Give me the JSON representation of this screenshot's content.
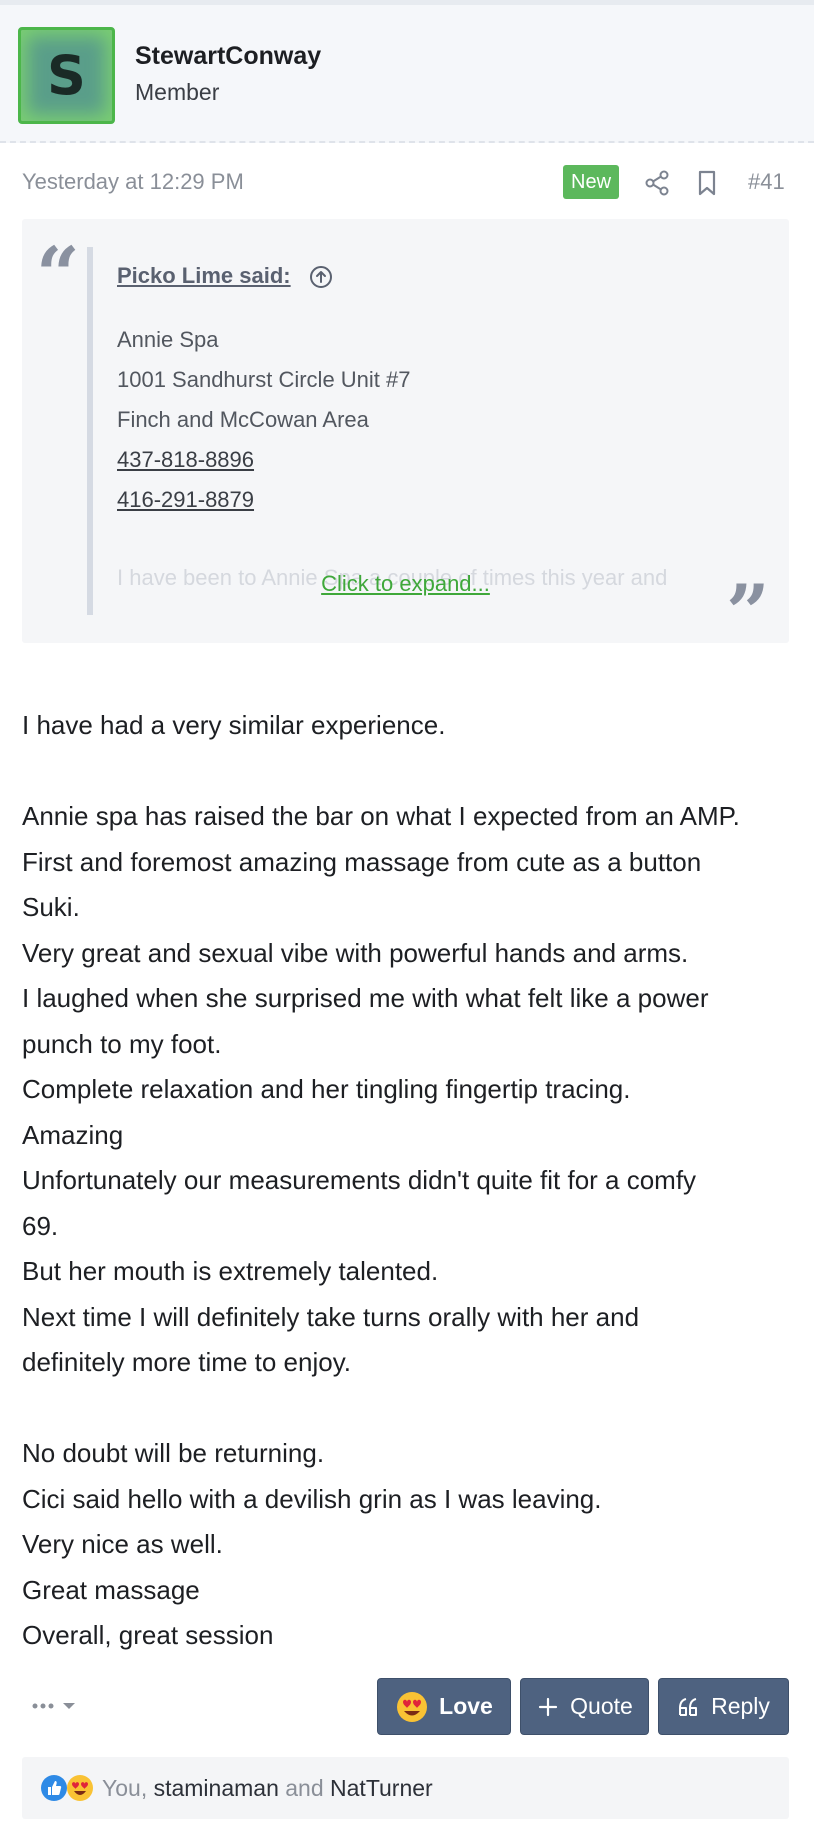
{
  "user": {
    "avatar_letter": "S",
    "name": "StewartConway",
    "title": "Member"
  },
  "post_meta": {
    "date": "Yesterday at 12:29 PM",
    "badge": "New",
    "number": "#41"
  },
  "quote": {
    "attribution": "Picko Lime said:",
    "lines": [
      "Annie Spa",
      "1001 Sandhurst Circle Unit #7",
      "Finch and McCowan Area"
    ],
    "phones": [
      "437-818-8896",
      "416-291-8879"
    ],
    "faded_text": "I have been to Annie Spa a couple of times this year and",
    "expand_label": "Click to expand..."
  },
  "body_lines": [
    "I have had a very similar experience.",
    "",
    "Annie spa has raised the bar on what I expected from an AMP.",
    "First and foremost amazing massage from cute as a button",
    "Suki.",
    "Very great and sexual vibe with powerful hands and arms.",
    "I laughed when she surprised me with what felt like a power",
    "punch to my foot.",
    "Complete relaxation and her tingling fingertip tracing.",
    "Amazing",
    "Unfortunately our measurements didn't quite fit for a comfy",
    "69.",
    "But her mouth is extremely talented.",
    "Next time I will definitely take turns orally with her and",
    "definitely more time to enjoy.",
    "",
    "No doubt will be returning.",
    "Cici said hello with a devilish grin as I was leaving.",
    "Very nice as well.",
    "Great massage",
    "Overall, great session"
  ],
  "actions": {
    "love": "Love",
    "quote": "Quote",
    "reply": "Reply"
  },
  "reactions": {
    "you": "You,",
    "user1": "staminaman",
    "and": "and",
    "user2": "NatTurner"
  },
  "colors": {
    "accent_green": "#5cb85c",
    "button_bg": "#4e6280",
    "link_green": "#3fa83a"
  }
}
